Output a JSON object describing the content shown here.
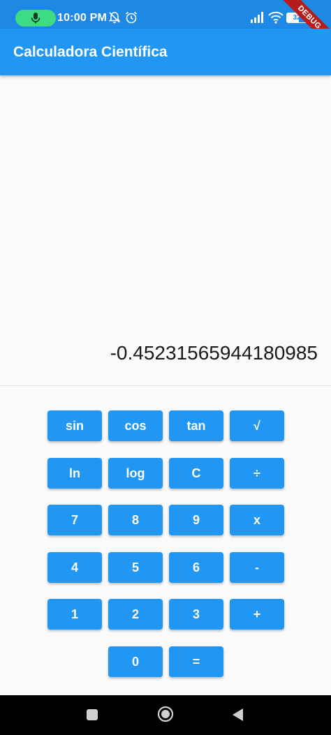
{
  "status_bar": {
    "time": "10:00 PM",
    "battery_level": "32",
    "icons": [
      "mic-icon",
      "notifications-off-icon",
      "alarm-icon",
      "signal-icon",
      "wifi-icon",
      "battery-icon"
    ],
    "debug_banner": "DEBUG"
  },
  "app_bar": {
    "title": "Calculadora Científica"
  },
  "display": {
    "value": "-0.45231565944180985"
  },
  "keypad": {
    "rows": [
      [
        "sin",
        "cos",
        "tan",
        "√"
      ],
      [
        "ln",
        "log",
        "C",
        "÷"
      ],
      [
        "7",
        "8",
        "9",
        "x"
      ],
      [
        "4",
        "5",
        "6",
        "-"
      ],
      [
        "1",
        "2",
        "3",
        "+"
      ],
      [
        "0",
        "="
      ]
    ]
  },
  "nav_bar": {
    "icons": [
      "square-icon",
      "circle-icon",
      "triangle-back-icon"
    ]
  },
  "colors": {
    "primary": "#2196f3",
    "status_bar": "#1e88e5",
    "background": "#fafafa",
    "mic_pill": "#3ddc84"
  }
}
